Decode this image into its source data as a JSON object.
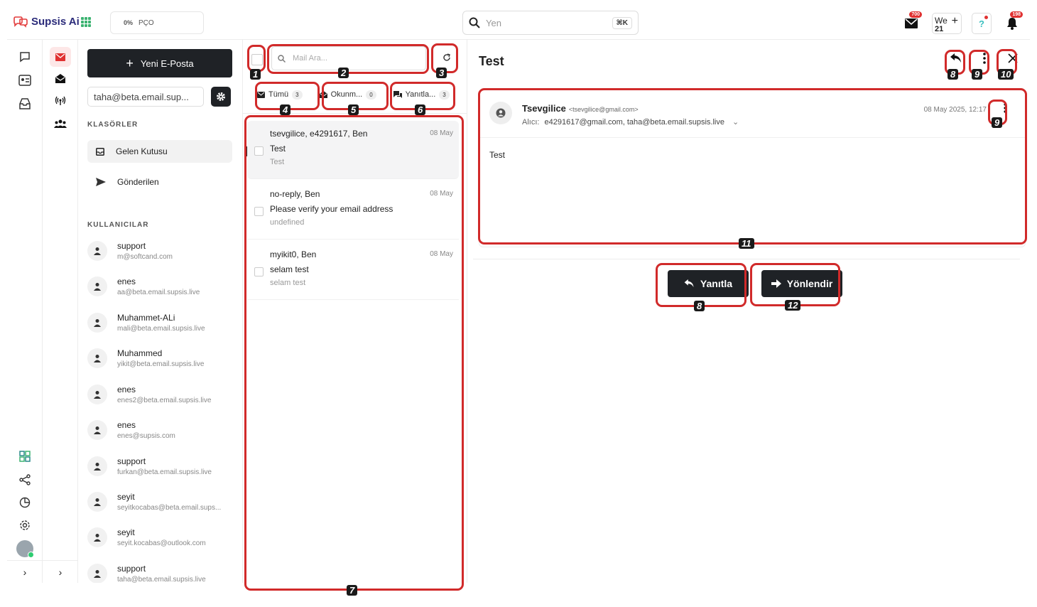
{
  "app": {
    "brand": "Supsis Ai",
    "org_pct": "0%",
    "org_name": "PÇO",
    "search_placeholder": "Yen",
    "search_shortcut": "⌘K",
    "mail_badge": "700",
    "we_label": "We",
    "we_count": "21",
    "notif_badge": "198"
  },
  "folders_panel": {
    "new_mail_label": "Yeni E-Posta",
    "account": "taha@beta.email.sup...",
    "folders_title": "KLASÖRLER",
    "folders": [
      {
        "label": "Gelen Kutusu",
        "icon": "inbox-icon"
      },
      {
        "label": "Gönderilen",
        "icon": "send-icon"
      }
    ],
    "users_title": "KULLANICILAR",
    "users": [
      {
        "name": "support",
        "email": "m@softcand.com"
      },
      {
        "name": "enes",
        "email": "aa@beta.email.supsis.live"
      },
      {
        "name": "Muhammet-ALi",
        "email": "mali@beta.email.supsis.live"
      },
      {
        "name": "Muhammed",
        "email": "yikit@beta.email.supsis.live"
      },
      {
        "name": "enes",
        "email": "enes2@beta.email.supsis.live"
      },
      {
        "name": "enes",
        "email": "enes@supsis.com"
      },
      {
        "name": "support",
        "email": "furkan@beta.email.supsis.live"
      },
      {
        "name": "seyit",
        "email": "seyitkocabas@beta.email.sups..."
      },
      {
        "name": "seyit",
        "email": "seyit.kocabas@outlook.com"
      },
      {
        "name": "support",
        "email": "taha@beta.email.supsis.live"
      }
    ]
  },
  "mail_list": {
    "search_placeholder": "Mail Ara...",
    "filters": [
      {
        "label": "Tümü",
        "count": "3"
      },
      {
        "label": "Okunm...",
        "count": "0"
      },
      {
        "label": "Yanıtla...",
        "count": "3"
      }
    ],
    "items": [
      {
        "from": "tsevgilice, e4291617, Ben",
        "date": "08 May",
        "subject": "Test",
        "snippet": "Test"
      },
      {
        "from": "no-reply, Ben",
        "date": "08 May",
        "subject": "Please verify your email address",
        "snippet": "undefined"
      },
      {
        "from": "myikit0, Ben",
        "date": "08 May",
        "subject": "selam test",
        "snippet": "selam test"
      }
    ]
  },
  "reader": {
    "title": "Test",
    "sender_name": "Tsevgilice",
    "sender_email": "<tsevgilice@gmail.com>",
    "to_label": "Alıcı:",
    "to_value": "e4291617@gmail.com, taha@beta.email.supsis.live",
    "date": "08 May 2025, 12:17",
    "body": "Test",
    "reply_label": "Yanıtla",
    "forward_label": "Yönlendir"
  },
  "annotations": [
    "1",
    "2",
    "3",
    "4",
    "5",
    "6",
    "7",
    "8",
    "9",
    "10",
    "11",
    "8",
    "12",
    "9"
  ],
  "colors": {
    "accent": "#d12a2a",
    "dark_button": "#1f2226",
    "active_tab_bg": "#fde7e7"
  }
}
